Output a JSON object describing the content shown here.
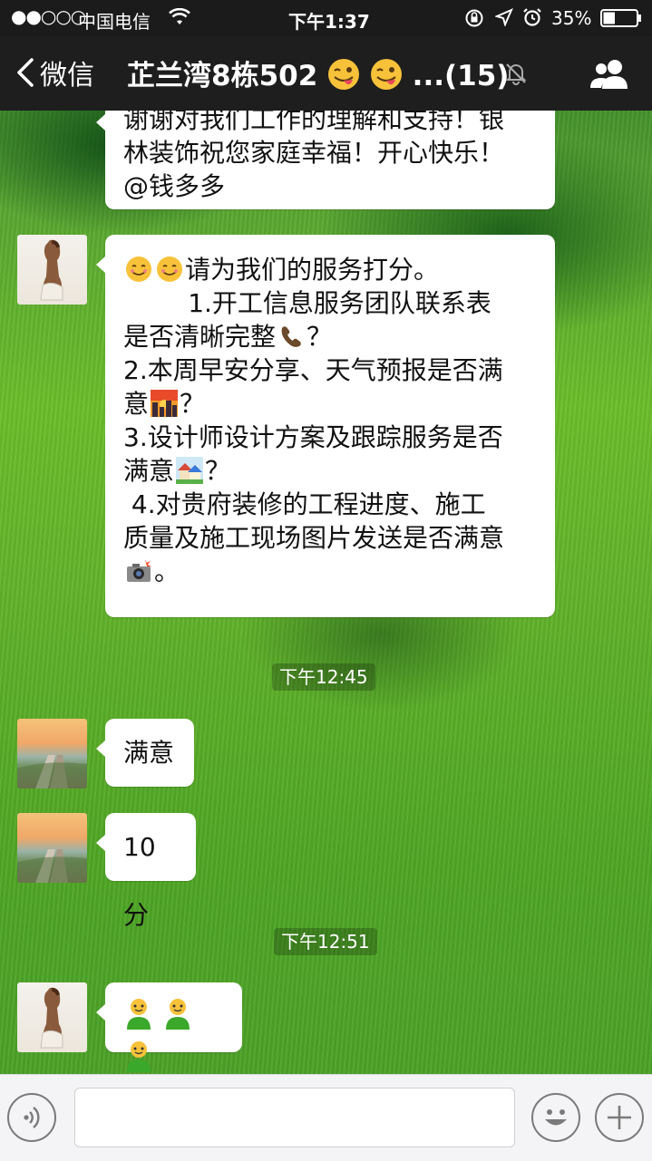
{
  "status_bar": {
    "signal": "●●○○○",
    "carrier": "中国电信",
    "time": "下午1:37",
    "battery": "35%",
    "icons": [
      "wifi-icon",
      "rotation-lock-icon",
      "location-icon",
      "alarm-icon",
      "battery-icon"
    ]
  },
  "nav": {
    "back_label": "微信",
    "title": "芷兰湾8栋502",
    "title_suffix": "...(15)",
    "icons": [
      "back-chevron-icon",
      "tongue-wink-emoji",
      "mute-bell-icon",
      "group-members-icon"
    ]
  },
  "messages": [
    {
      "type": "text",
      "lines": [
        "谢谢对我们工作的理解和支持！银",
        "林装饰祝您家庭幸福！开心快乐！",
        "@钱多多"
      ]
    },
    {
      "type": "text",
      "avatar": "avatar-girl",
      "lines": [
        "请为我们的服务打分。",
        "        1.开工信息服务团队联系表",
        "是否清晰完整",
        "？",
        "2.本周早安分享、天气预报是否满",
        "意",
        "？",
        "3.设计师设计方案及跟踪服务是否",
        "满意",
        "？",
        " 4.对贵府装修的工程进度、施工",
        "质量及施工现场图片发送是否满意",
        "。"
      ],
      "emoji_names": [
        "smile-emoji",
        "smile-emoji",
        "telephone-emoji",
        "sunset-city-emoji",
        "houses-emoji",
        "camera-flash-emoji"
      ]
    },
    {
      "type": "timestamp",
      "text": "下午12:45"
    },
    {
      "type": "text",
      "avatar": "avatar-beach",
      "text": "满意"
    },
    {
      "type": "text",
      "avatar": "avatar-beach",
      "text": "10分"
    },
    {
      "type": "timestamp",
      "text": "下午12:51"
    },
    {
      "type": "sticker",
      "avatar": "avatar-girl",
      "emoji_names": [
        "green-man-emoji",
        "green-man-emoji",
        "green-man-emoji"
      ]
    }
  ],
  "input_bar": {
    "icons": [
      "voice-icon",
      "emoji-icon",
      "plus-icon"
    ],
    "placeholder": ""
  }
}
